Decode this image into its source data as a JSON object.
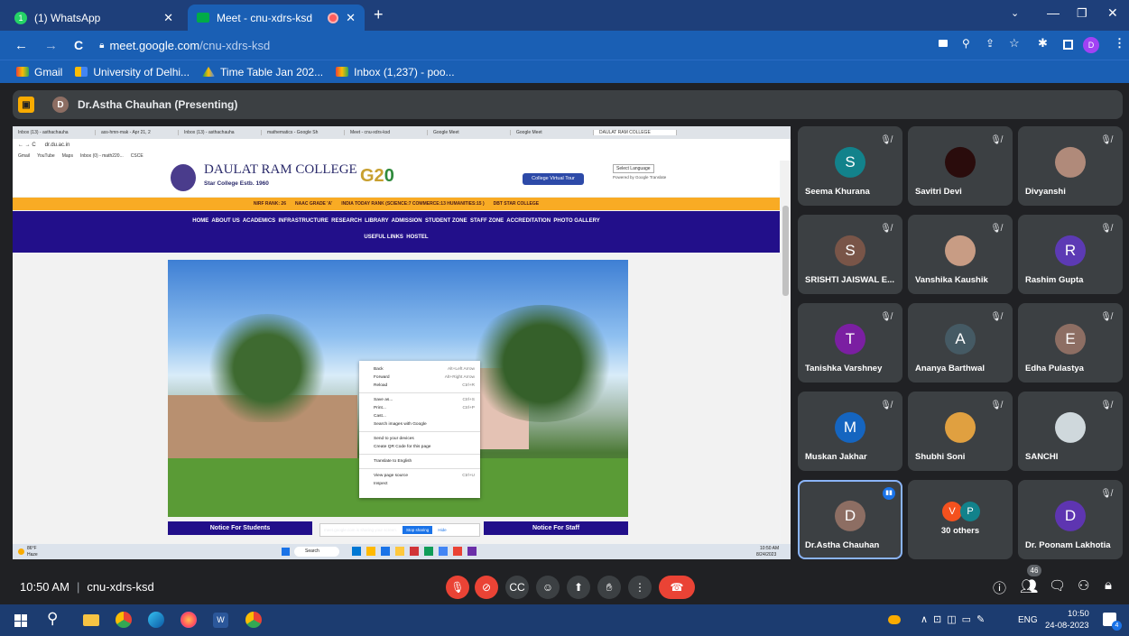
{
  "browser": {
    "tabs": [
      {
        "label": "(1) WhatsApp",
        "badge": "1"
      },
      {
        "label": "Meet - cnu-xdrs-ksd"
      }
    ],
    "url_domain": "meet.google.com",
    "url_path": "/cnu-xdrs-ksd",
    "bookmarks": [
      "Gmail",
      "University of Delhi...",
      "Time Table Jan 202...",
      "Inbox (1,237) - poo..."
    ],
    "profile_initial": "D"
  },
  "meet": {
    "presenter_initial": "D",
    "presenter_label": "Dr.Astha Chauhan (Presenting)",
    "time": "10:50 AM",
    "meeting_code": "cnu-xdrs-ksd",
    "people_count": "46"
  },
  "shared": {
    "tabs": [
      "Inbox (13) - asthachauha",
      "ass-hmn-mak - Apr 21, 2",
      "Inbox (13) - asthachauha",
      "mathematics - Google Sh",
      "Meet - cnu-xdrs-ksd",
      "Google Meet",
      "Google Meet",
      "DAULAT RAM COLLEGE"
    ],
    "url": "dr.du.ac.in",
    "bookmarks": [
      "Gmail",
      "YouTube",
      "Maps",
      "Inbox (0) - math220...",
      "CSCE"
    ],
    "college_name": "DAULAT RAM COLLEGE",
    "college_sub": "Star College",
    "estd": "Estb. 1960",
    "virtual_tour": "College Virtual Tour",
    "select_language": "Select Language",
    "powered_by": "Powered by Google Translate",
    "ticker": [
      "NIRF RANK: 26",
      "NAAC GRADE 'A'",
      "INDIA TODAY RANK (SCIENCE:7 COMMERCE:13 HUMANITIES:15 )",
      "DBT STAR COLLEGE"
    ],
    "nav1": "HOME  ABOUT US  ACADEMICS  INFRASTRUCTURE  RESEARCH  LIBRARY  ADMISSION  STUDENT ZONE  STAFF ZONE  ACCREDITATION  PHOTO GALLERY",
    "nav2": "USEFUL LINKS  HOSTEL",
    "context_menu": [
      {
        "label": "Back",
        "key": "Alt+Left Arrow"
      },
      {
        "label": "Forward",
        "key": "Alt+Right Arrow"
      },
      {
        "label": "Reload",
        "key": "Ctrl+R"
      },
      {
        "label": "Save as...",
        "key": "Ctrl+S"
      },
      {
        "label": "Print...",
        "key": "Ctrl+P"
      },
      {
        "label": "Cast...",
        "key": ""
      },
      {
        "label": "Search images with Google",
        "key": ""
      },
      {
        "label": "Send to your devices",
        "key": ""
      },
      {
        "label": "Create QR Code for this page",
        "key": ""
      },
      {
        "label": "Translate to English",
        "key": ""
      },
      {
        "label": "View page source",
        "key": "Ctrl+U"
      },
      {
        "label": "Inspect",
        "key": ""
      }
    ],
    "notice_students": "Notice For Students",
    "notice_staff": "Notice For Staff",
    "sharing_text": "meet.google.com is sharing your screen.",
    "stop_sharing": "Stop sharing",
    "hide": "Hide",
    "weather": "86°F",
    "weather_desc": "Haze",
    "taskbar_search": "Search",
    "taskbar_time": "10:50 AM",
    "taskbar_date": "8/24/2023"
  },
  "participants": [
    {
      "name": "Seema Khurana",
      "initial": "S",
      "color": "#12828b"
    },
    {
      "name": "Savitri Devi",
      "initial": "",
      "color": "#2a0c0c"
    },
    {
      "name": "Divyanshi",
      "initial": "",
      "color": "#b08a7a"
    },
    {
      "name": "SRISHTI JAISWAL E...",
      "initial": "S",
      "color": "#795548"
    },
    {
      "name": "Vanshika Kaushik",
      "initial": "",
      "color": "#c89c84"
    },
    {
      "name": "Rashim Gupta",
      "initial": "R",
      "color": "#5c3ab4"
    },
    {
      "name": "Tanishka Varshney",
      "initial": "T",
      "color": "#7b1fa2"
    },
    {
      "name": "Ananya Barthwal",
      "initial": "A",
      "color": "#455a64"
    },
    {
      "name": "Edha Pulastya",
      "initial": "E",
      "color": "#8d6e63"
    },
    {
      "name": "Muskan Jakhar",
      "initial": "M",
      "color": "#1565c0"
    },
    {
      "name": "Shubhi Soni",
      "initial": "",
      "color": "#e0a040"
    },
    {
      "name": "SANCHI",
      "initial": "",
      "color": "#cfd8dc"
    },
    {
      "name": "Dr.Astha Chauhan",
      "initial": "D",
      "color": "#8d6e63"
    },
    {
      "name": "30 others",
      "initial": "",
      "color": "#3c4043"
    },
    {
      "name": "Dr. Poonam Lakhotia",
      "initial": "D",
      "color": "#5e35b1"
    }
  ],
  "others_initials": [
    "V",
    "P"
  ],
  "windows": {
    "language": "ENG",
    "time": "10:50",
    "date": "24-08-2023",
    "notif_count": "4"
  }
}
